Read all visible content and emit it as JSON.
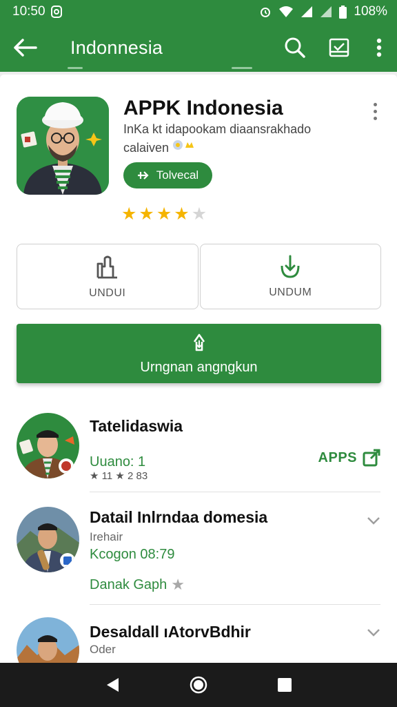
{
  "status_bar": {
    "time": "10:50",
    "battery": "108%"
  },
  "app_bar": {
    "title": "Indonnesia"
  },
  "app": {
    "name": "APPK Indonesia",
    "description_line1": "InKa kt idapookam diaansrakhado",
    "description_line2": "calaiven",
    "install_label": "Tolvecal",
    "rating": 4,
    "rating_max": 5
  },
  "buttons": {
    "left_label": "UNDUI",
    "right_label": "UNDUM",
    "primary_label": "Urngnan angngkun"
  },
  "list": [
    {
      "title": "Tatelidaswia",
      "green_line": "Uuano: 1",
      "stats": "★ 11  ★ 2  83",
      "action": "APPS"
    },
    {
      "title": "Datail Inlrndaa domesia",
      "sub": "Irehair",
      "green_line": "Kcogon 08:79",
      "green_line2": "Danak Gaph"
    },
    {
      "title": "Desaldall ıAtorvBdhir",
      "sub": "Oder"
    }
  ],
  "colors": {
    "primary": "#2e8b3e",
    "star": "#f5b400"
  }
}
